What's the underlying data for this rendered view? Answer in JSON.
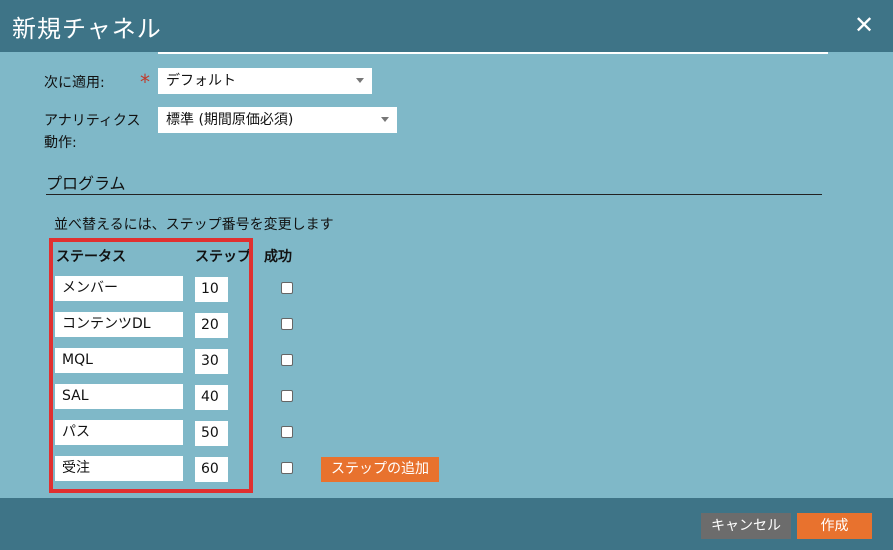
{
  "dialog": {
    "title": "新規チャネル"
  },
  "form": {
    "apply_to_label": "次に適用:",
    "apply_to_value": "デフォルト",
    "analytics_label_line1": "アナリティクス",
    "analytics_label_line2": "動作:",
    "analytics_value": "標準 (期間原価必須)"
  },
  "program": {
    "section_title": "プログラム",
    "hint": "並べ替えるには、ステップ番号を変更します",
    "headers": {
      "status": "ステータス",
      "step": "ステップ",
      "success": "成功"
    },
    "rows": [
      {
        "status": "メンバー",
        "step": "10",
        "success": false
      },
      {
        "status": "コンテンツDL",
        "step": "20",
        "success": false
      },
      {
        "status": "MQL",
        "step": "30",
        "success": false
      },
      {
        "status": "SAL",
        "step": "40",
        "success": false
      },
      {
        "status": "パス",
        "step": "50",
        "success": false
      },
      {
        "status": "受注",
        "step": "60",
        "success": false
      }
    ],
    "add_step_label": "ステップの追加"
  },
  "footer": {
    "cancel_label": "キャンセル",
    "create_label": "作成"
  },
  "colors": {
    "header": "#3e7487",
    "background": "#7fb8c8",
    "accent": "#e8722e",
    "highlight": "#e03030"
  }
}
